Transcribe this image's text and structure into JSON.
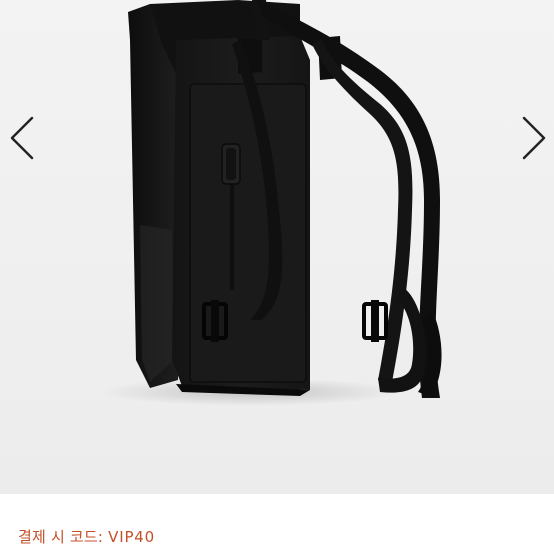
{
  "product_image": {
    "subject": "backpack-photo"
  },
  "carousel": {
    "prev_icon": "chevron-left-icon",
    "next_icon": "chevron-right-icon"
  },
  "promo": {
    "label": "결제 시 코드:",
    "code": "VIP40",
    "color": "#c4502a"
  }
}
